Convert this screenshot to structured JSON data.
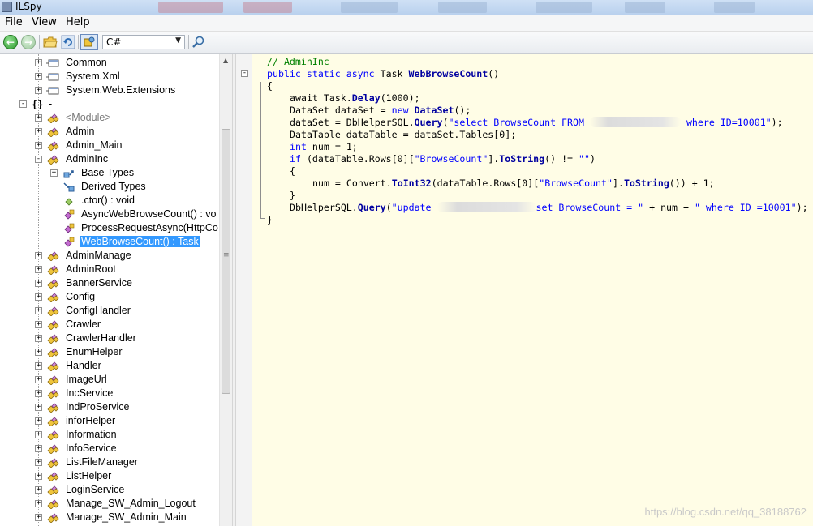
{
  "window": {
    "title": "ILSpy"
  },
  "menu": [
    "File",
    "View",
    "Help"
  ],
  "toolbar": {
    "language": "C#"
  },
  "tree": [
    {
      "label": "Common",
      "depth": 1,
      "expander": "+",
      "icon": "reference-icon"
    },
    {
      "label": "System.Xml",
      "depth": 1,
      "expander": "+",
      "icon": "reference-icon"
    },
    {
      "label": "System.Web.Extensions",
      "depth": 1,
      "expander": "+",
      "icon": "reference-icon"
    },
    {
      "label": "-",
      "depth": 0,
      "expander": "-",
      "icon": "namespace-icon"
    },
    {
      "label": "<Module>",
      "depth": 1,
      "expander": "+",
      "icon": "class-icon",
      "gray": true
    },
    {
      "label": "Admin",
      "depth": 1,
      "expander": "+",
      "icon": "class-icon"
    },
    {
      "label": "Admin_Main",
      "depth": 1,
      "expander": "+",
      "icon": "class-icon"
    },
    {
      "label": "AdminInc",
      "depth": 1,
      "expander": "-",
      "icon": "class-icon"
    },
    {
      "label": "Base Types",
      "depth": 2,
      "expander": "+",
      "icon": "base-types-icon"
    },
    {
      "label": "Derived Types",
      "depth": 2,
      "expander": "",
      "icon": "derived-types-icon"
    },
    {
      "label": ".ctor() : void",
      "depth": 2,
      "expander": "",
      "icon": "constructor-icon"
    },
    {
      "label": "AsyncWebBrowseCount() : vo",
      "depth": 2,
      "expander": "",
      "icon": "method-icon"
    },
    {
      "label": "ProcessRequestAsync(HttpCo",
      "depth": 2,
      "expander": "",
      "icon": "method-icon"
    },
    {
      "label": "WebBrowseCount() : Task",
      "depth": 2,
      "expander": "",
      "icon": "method-icon",
      "selected": true
    },
    {
      "label": "AdminManage",
      "depth": 1,
      "expander": "+",
      "icon": "class-icon"
    },
    {
      "label": "AdminRoot",
      "depth": 1,
      "expander": "+",
      "icon": "class-icon"
    },
    {
      "label": "BannerService",
      "depth": 1,
      "expander": "+",
      "icon": "class-icon"
    },
    {
      "label": "Config",
      "depth": 1,
      "expander": "+",
      "icon": "class-icon"
    },
    {
      "label": "ConfigHandler",
      "depth": 1,
      "expander": "+",
      "icon": "class-icon"
    },
    {
      "label": "Crawler",
      "depth": 1,
      "expander": "+",
      "icon": "class-icon"
    },
    {
      "label": "CrawlerHandler",
      "depth": 1,
      "expander": "+",
      "icon": "class-icon"
    },
    {
      "label": "EnumHelper",
      "depth": 1,
      "expander": "+",
      "icon": "class-icon"
    },
    {
      "label": "Handler",
      "depth": 1,
      "expander": "+",
      "icon": "class-icon"
    },
    {
      "label": "ImageUrl",
      "depth": 1,
      "expander": "+",
      "icon": "class-icon"
    },
    {
      "label": "IncService",
      "depth": 1,
      "expander": "+",
      "icon": "class-icon"
    },
    {
      "label": "IndProService",
      "depth": 1,
      "expander": "+",
      "icon": "class-icon"
    },
    {
      "label": "inforHelper",
      "depth": 1,
      "expander": "+",
      "icon": "class-icon"
    },
    {
      "label": "Information",
      "depth": 1,
      "expander": "+",
      "icon": "class-icon"
    },
    {
      "label": "InfoService",
      "depth": 1,
      "expander": "+",
      "icon": "class-icon"
    },
    {
      "label": "ListFileManager",
      "depth": 1,
      "expander": "+",
      "icon": "class-icon"
    },
    {
      "label": "ListHelper",
      "depth": 1,
      "expander": "+",
      "icon": "class-icon"
    },
    {
      "label": "LoginService",
      "depth": 1,
      "expander": "+",
      "icon": "class-icon"
    },
    {
      "label": "Manage_SW_Admin_Logout",
      "depth": 1,
      "expander": "+",
      "icon": "class-icon"
    },
    {
      "label": "Manage_SW_Admin_Main",
      "depth": 1,
      "expander": "+",
      "icon": "class-icon"
    }
  ],
  "code": {
    "comment": "// AdminInc",
    "sig_kw": "public static async",
    "sig_type": " Task ",
    "sig_name": "WebBrowseCount",
    "sig_tail": "()",
    "l_open": "{",
    "l1_a": "await Task.",
    "l1_m": "Delay",
    "l1_b": "(1000);",
    "l2_a": "DataSet dataSet = ",
    "l2_kw": "new",
    "l2_sp": " ",
    "l2_m": "DataSet",
    "l2_b": "();",
    "l3_a": "dataSet = DbHelperSQL.",
    "l3_m": "Query",
    "l3_b": "(",
    "l3_s1": "\"select BrowseCount FROM ",
    "l3_s2": " where ID=10001\"",
    "l3_c": ");",
    "l4": "DataTable dataTable = dataSet.Tables[0];",
    "l5_kw": "int",
    "l5_b": " num = 1;",
    "l6_kw": "if",
    "l6_a": " (dataTable.Rows[0][",
    "l6_s": "\"BrowseCount\"",
    "l6_b": "].",
    "l6_m": "ToString",
    "l6_c": "() != ",
    "l6_s2": "\"\"",
    "l6_d": ")",
    "l7": "{",
    "l8_a": "num = Convert.",
    "l8_m": "ToInt32",
    "l8_b": "(dataTable.Rows[0][",
    "l8_s": "\"BrowseCount\"",
    "l8_c": "].",
    "l8_m2": "ToString",
    "l8_d": "()) + 1;",
    "l9": "}",
    "l10_a": "DbHelperSQL.",
    "l10_m": "Query",
    "l10_b": "(",
    "l10_s1": "\"update ",
    "l10_s2": "set BrowseCount = \"",
    "l10_c": " + num + ",
    "l10_s3": "\" where ID =10001\"",
    "l10_d": ");",
    "l_close": "}"
  },
  "watermark": "https://blog.csdn.net/qq_38188762"
}
